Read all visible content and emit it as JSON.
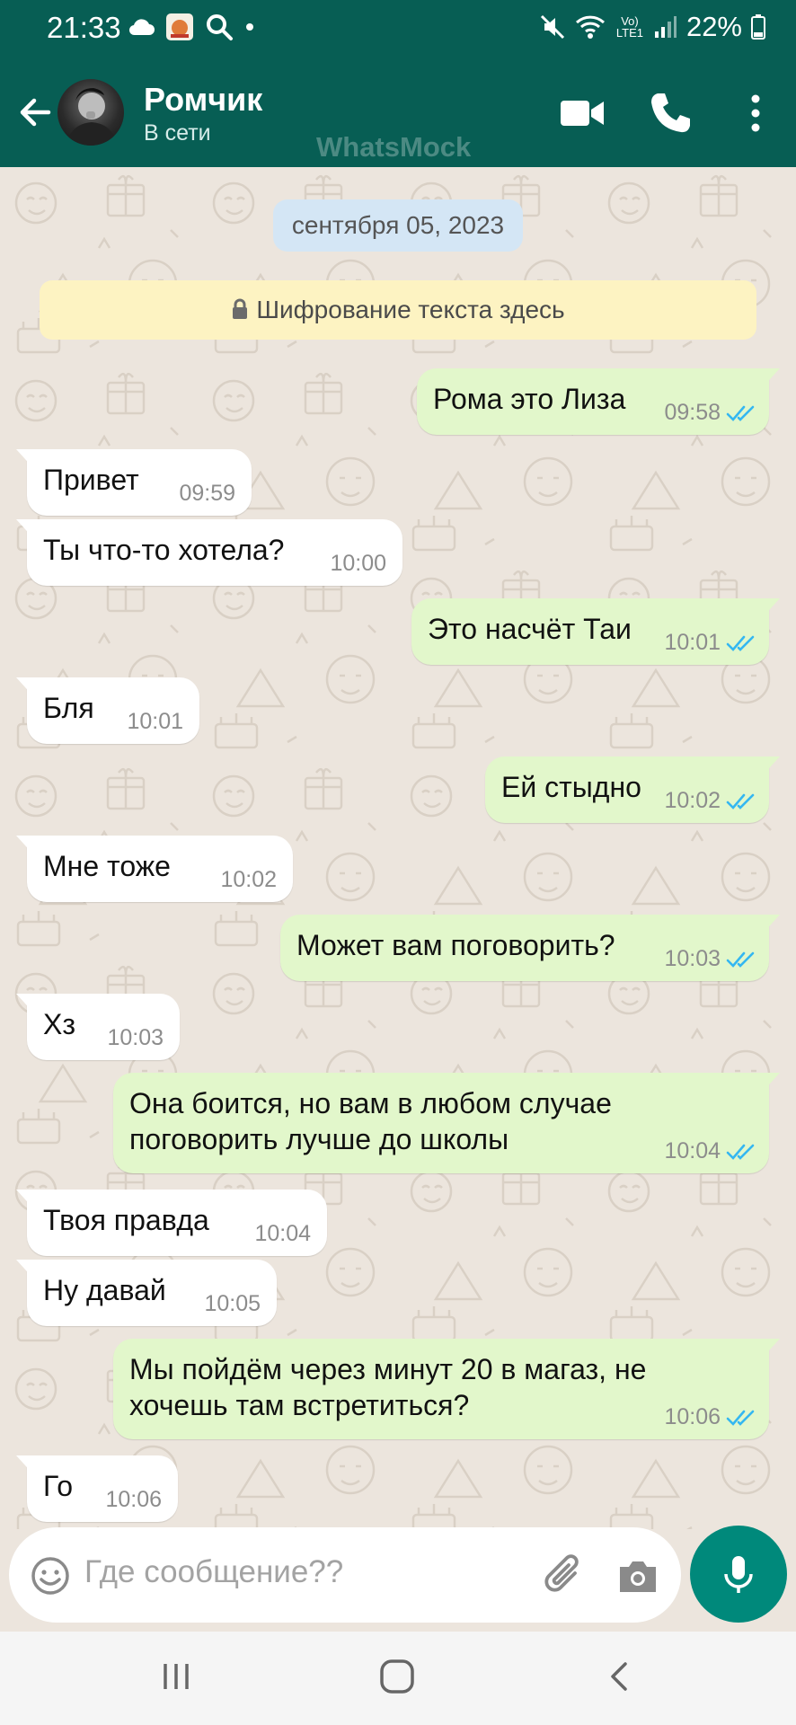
{
  "status_bar": {
    "time": "21:33",
    "battery": "22%",
    "signal_label": "Vo) LTE1"
  },
  "header": {
    "contact_name": "Ромчик",
    "contact_status": "В сети",
    "watermark": "WhatsMock"
  },
  "chat": {
    "date_label": "сентября 05, 2023",
    "encryption_notice": "Шифрование текста здесь",
    "messages": [
      {
        "dir": "out",
        "lines": [
          "Рома это Лиза"
        ],
        "time": "09:58",
        "read": true
      },
      {
        "dir": "in",
        "lines": [
          "Привет"
        ],
        "time": "09:59"
      },
      {
        "dir": "in",
        "lines": [
          "Ты что-то хотела?"
        ],
        "time": "10:00"
      },
      {
        "dir": "out",
        "lines": [
          "Это насчёт Таи"
        ],
        "time": "10:01",
        "read": true
      },
      {
        "dir": "in",
        "lines": [
          "Бля"
        ],
        "time": "10:01"
      },
      {
        "dir": "out",
        "lines": [
          "Ей стыдно"
        ],
        "time": "10:02",
        "read": true
      },
      {
        "dir": "in",
        "lines": [
          "Мне тоже"
        ],
        "time": "10:02"
      },
      {
        "dir": "out",
        "lines": [
          "Может вам поговорить?"
        ],
        "time": "10:03",
        "read": true
      },
      {
        "dir": "in",
        "lines": [
          "Хз"
        ],
        "time": "10:03"
      },
      {
        "dir": "out",
        "lines": [
          "Она боится, но вам в любом случае",
          "поговорить лучше до школы"
        ],
        "time": "10:04",
        "read": true
      },
      {
        "dir": "in",
        "lines": [
          "Твоя правда"
        ],
        "time": "10:04"
      },
      {
        "dir": "in",
        "lines": [
          "Ну давай"
        ],
        "time": "10:05"
      },
      {
        "dir": "out",
        "lines": [
          "Мы пойдём через минут 20 в магаз, не",
          "хочешь там встретиться?"
        ],
        "time": "10:06",
        "read": true
      },
      {
        "dir": "in",
        "lines": [
          "Го"
        ],
        "time": "10:06"
      }
    ]
  },
  "input": {
    "placeholder": "Где сообщение??"
  },
  "colors": {
    "header": "#075e54",
    "incoming_bubble": "#ffffff",
    "outgoing_bubble": "#e2f7cb",
    "read_tick": "#34b7f1",
    "mic_button": "#00897b"
  }
}
